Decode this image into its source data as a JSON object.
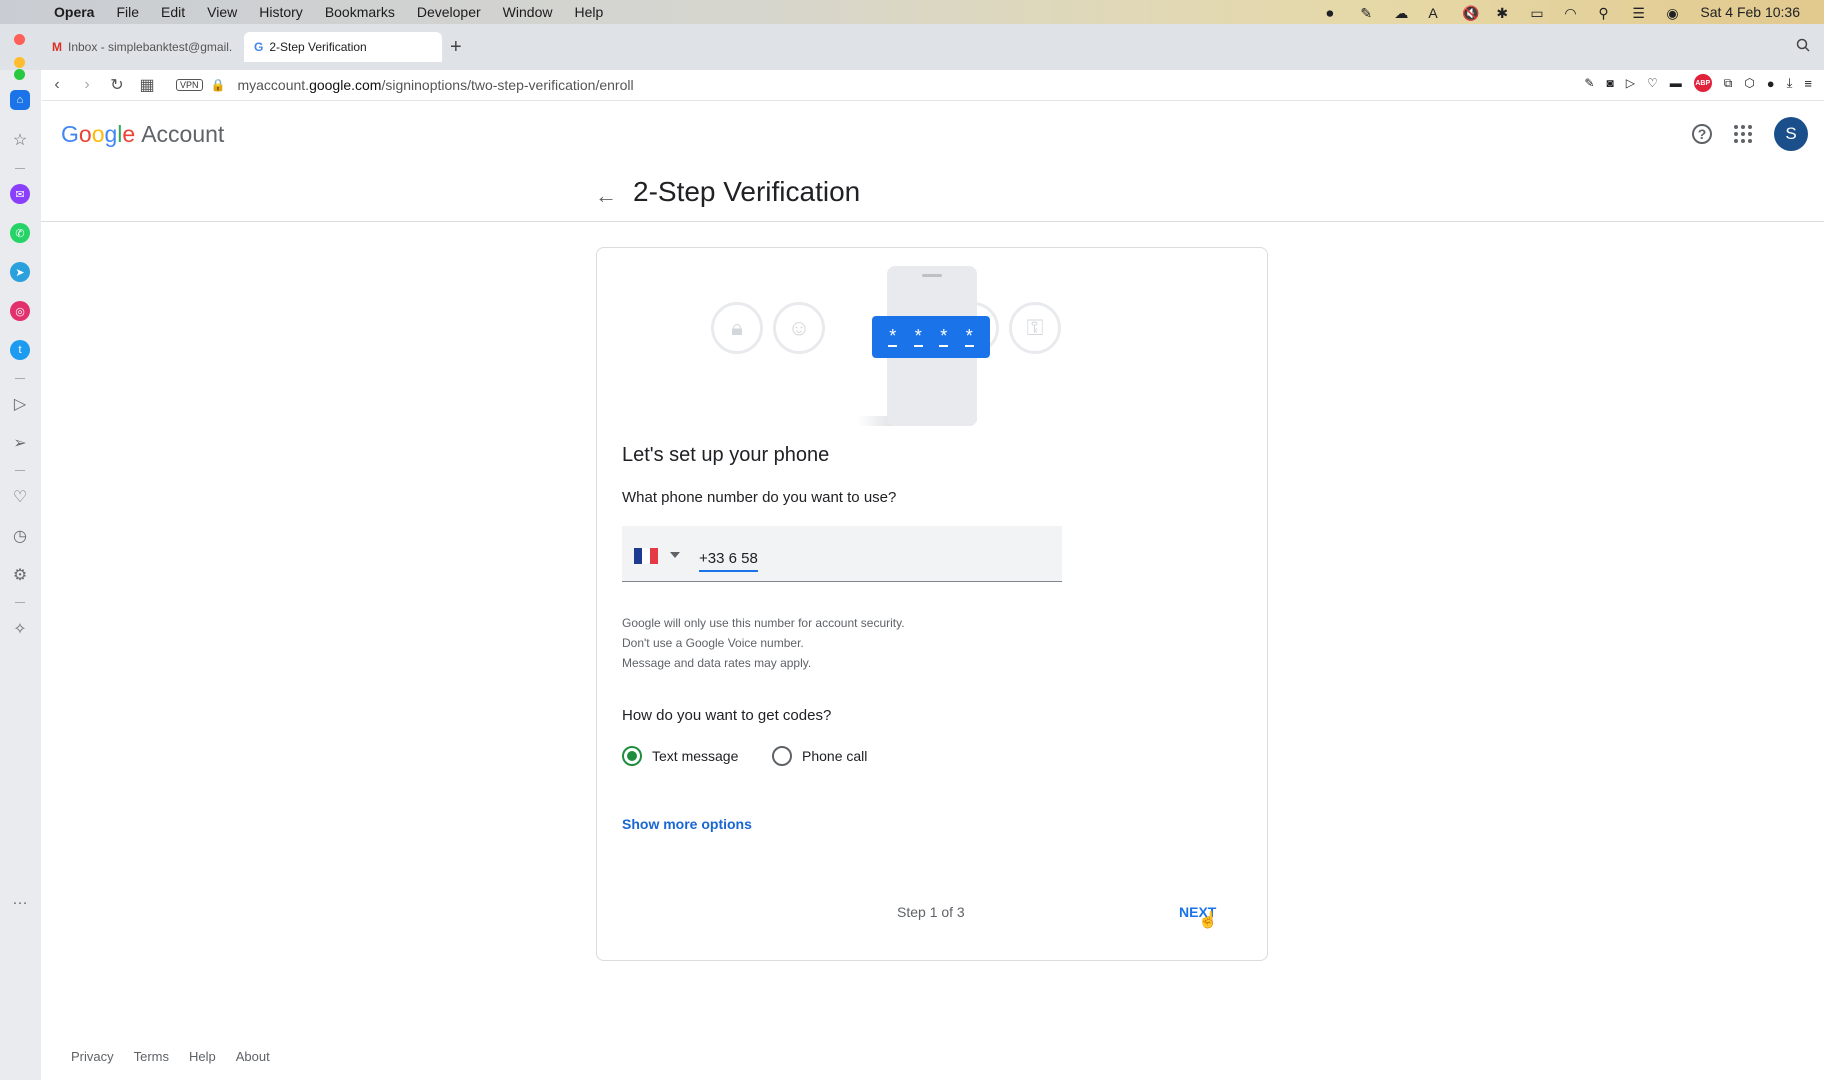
{
  "menubar": {
    "app": "Opera",
    "items": [
      "File",
      "Edit",
      "View",
      "History",
      "Bookmarks",
      "Developer",
      "Window",
      "Help"
    ],
    "datetime": "Sat 4 Feb  10:36"
  },
  "tabs": [
    {
      "label": "Inbox - simplebanktest@gmail...",
      "favicon": "M",
      "active": false
    },
    {
      "label": "2-Step Verification",
      "favicon": "G",
      "active": true
    }
  ],
  "address": {
    "vpn": "VPN",
    "url_prefix": "myaccount.",
    "url_domain": "google.com",
    "url_path": "/signinoptions/two-step-verification/enroll"
  },
  "header": {
    "logo_google": "Google",
    "logo_account": "Account",
    "avatar_initial": "S"
  },
  "main": {
    "title": "2-Step Verification",
    "heading": "Let's set up your phone",
    "phone_question": "What phone number do you want to use?",
    "phone_value": "+33 6 58",
    "fine_print": [
      "Google will only use this number for account security.",
      "Don't use a Google Voice number.",
      "Message and data rates may apply."
    ],
    "codes_question": "How do you want to get codes?",
    "options": [
      {
        "label": "Text message",
        "selected": true
      },
      {
        "label": "Phone call",
        "selected": false
      }
    ],
    "more_options": "Show more options",
    "step": "Step 1 of 3",
    "next": "NEXT",
    "code_chars": [
      "*",
      "*",
      "*",
      "*"
    ]
  },
  "footer": [
    "Privacy",
    "Terms",
    "Help",
    "About"
  ],
  "colors": {
    "accent": "#1a73e8",
    "radio_selected": "#1e8e3e",
    "avatar": "#1a4f8b"
  }
}
